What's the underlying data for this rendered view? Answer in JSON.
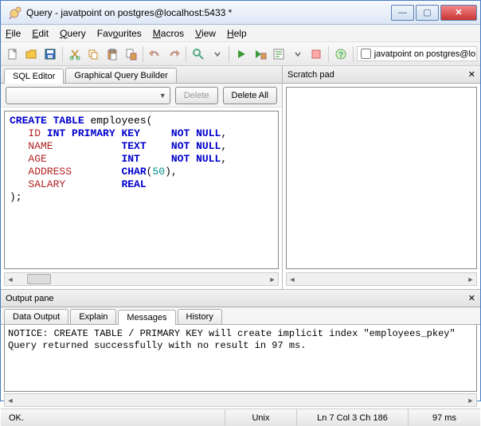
{
  "window": {
    "title": "Query - javatpoint on postgres@localhost:5433 *",
    "min": "—",
    "max": "▢",
    "close": "✕"
  },
  "menu": {
    "file": "File",
    "edit": "Edit",
    "query": "Query",
    "favourites": "Favourites",
    "macros": "Macros",
    "view": "View",
    "help": "Help"
  },
  "toolbar_combo": {
    "label": "javatpoint on postgres@lo"
  },
  "left": {
    "tabs": {
      "sql_editor": "SQL Editor",
      "gqb": "Graphical Query Builder"
    },
    "buttons": {
      "delete": "Delete",
      "delete_all": "Delete All"
    },
    "sql": {
      "line1": {
        "a": "CREATE",
        "b": " ",
        "c": "TABLE",
        "d": " employees("
      },
      "line2": {
        "pad": "   ",
        "a": "ID",
        "b": " ",
        "c": "INT",
        "d": " ",
        "e": "PRIMARY",
        "f": " ",
        "g": "KEY",
        "h": "     ",
        "i": "NOT",
        "j": " ",
        "k": "NULL",
        "l": ","
      },
      "line3": {
        "pad": "   ",
        "a": "NAME",
        "b": "           ",
        "c": "TEXT",
        "d": "    ",
        "e": "NOT",
        "f": " ",
        "g": "NULL",
        "h": ","
      },
      "line4": {
        "pad": "   ",
        "a": "AGE",
        "b": "            ",
        "c": "INT",
        "d": "     ",
        "e": "NOT",
        "f": " ",
        "g": "NULL",
        "h": ","
      },
      "line5": {
        "pad": "   ",
        "a": "ADDRESS",
        "b": "        ",
        "c": "CHAR",
        "d": "(",
        "e": "50",
        "f": "),"
      },
      "line6": {
        "pad": "   ",
        "a": "SALARY",
        "b": "         ",
        "c": "REAL"
      },
      "line7": ");"
    }
  },
  "scratch": {
    "title": "Scratch pad"
  },
  "output": {
    "title": "Output pane",
    "tabs": {
      "data": "Data Output",
      "explain": "Explain",
      "messages": "Messages",
      "history": "History"
    },
    "body_line1": "NOTICE:  CREATE TABLE / PRIMARY KEY will create implicit index \"employees_pkey\"",
    "body_line2": "Query returned successfully with no result in 97 ms."
  },
  "status": {
    "ok": "OK.",
    "mode": "Unix",
    "pos": "Ln 7 Col 3 Ch 186",
    "time": "97 ms"
  }
}
